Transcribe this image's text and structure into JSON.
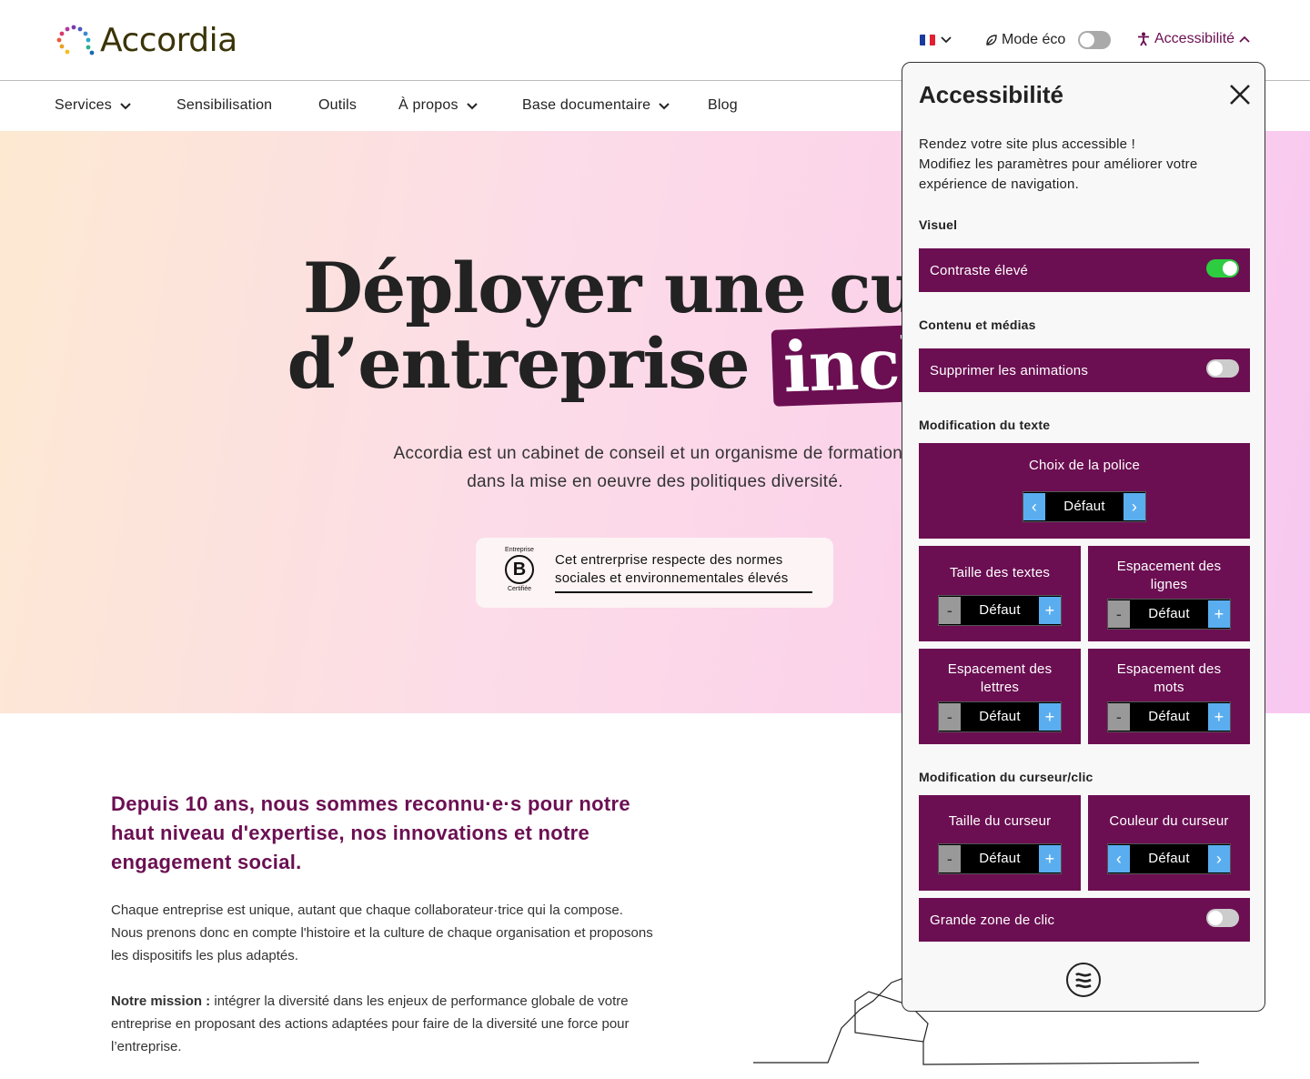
{
  "header": {
    "logo_text": "Accordia",
    "eco_label": "Mode éco",
    "accessibility_label": "Accessibilité"
  },
  "nav": {
    "items": [
      "Services",
      "Sensibilisation",
      "Outils",
      "À propos",
      "Base documentaire",
      "Blog"
    ]
  },
  "hero": {
    "title_line1": "Déployer une cultu",
    "title_line2_pre": "d’entreprise",
    "title_line2_highlight": "inclus",
    "subtitle_line1": "Accordia est un cabinet de conseil et un organisme de formation s",
    "subtitle_line2": "dans la mise en oeuvre des politiques diversité.",
    "bcorp": {
      "logo_top": "Entreprise",
      "logo_letter": "B",
      "logo_bottom": "Certifiée",
      "text": "Cet entrerprise respecte des normes sociales et  environnementales élevés"
    }
  },
  "intro": {
    "heading": "Depuis 10 ans, nous sommes reconnu·e·s pour notre haut niveau d'expertise, nos innovations et notre engagement social.",
    "para1": "Chaque entreprise est unique, autant que chaque collaborateur·trice qui la compose. Nous prenons donc en compte l'histoire et la culture de chaque organisation et proposons les dispositifs les plus adaptés.",
    "mission_label": "Notre mission :",
    "mission_text": " intégrer la diversité dans les enjeux de performance globale de votre entreprise en proposant des actions adaptées pour faire de la diversité une force pour l’entreprise."
  },
  "panel": {
    "title": "Accessibilité",
    "desc_line1": "Rendez votre site plus accessible !",
    "desc_line2": "Modifiez les paramètres pour améliorer votre expérience de navigation.",
    "sections": {
      "visuel": "Visuel",
      "contenu": "Contenu et médias",
      "texte": "Modification du texte",
      "curseur": "Modification du curseur/clic"
    },
    "toggles": {
      "contraste": {
        "label": "Contraste élevé",
        "on": true
      },
      "animations": {
        "label": "Supprimer les animations",
        "on": false
      },
      "zone_clic": {
        "label": "Grande zone de clic",
        "on": false
      }
    },
    "default_value": "Défaut",
    "police_label": "Choix de la police",
    "taille_textes": "Taille des textes",
    "espacement_lignes": "Espacement des lignes",
    "espacement_lettres": "Espacement des lettres",
    "espacement_mots": "Espacement des mots",
    "taille_curseur": "Taille du curseur",
    "couleur_curseur": "Couleur du curseur"
  },
  "colors": {
    "brand": "#6b0f52",
    "toggle_on": "#2ecc40",
    "stepper_button": "#5aaef0"
  }
}
